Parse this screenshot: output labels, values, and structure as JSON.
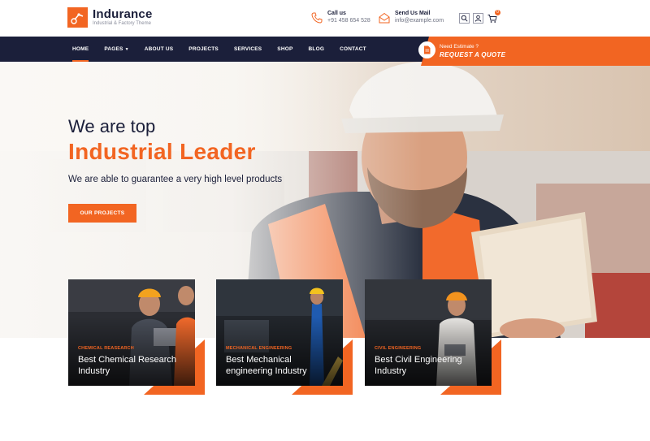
{
  "header": {
    "brand": "Indurance",
    "tagline": "Industrial & Factory Theme",
    "call_label": "Call us",
    "call_value": "+91 458 654 528",
    "mail_label": "Send Us Mail",
    "mail_value": "info@example.com",
    "cart_count": "0"
  },
  "nav": {
    "items": [
      "HOME",
      "PAGES",
      "ABOUT US",
      "PROJECTS",
      "SERVICES",
      "SHOP",
      "BLOG",
      "CONTACT"
    ],
    "quote_small": "Need Estimate ?",
    "quote_big": "REQUEST A QUOTE"
  },
  "hero": {
    "line1": "We are top",
    "title": "Industrial Leader",
    "desc": "We are able to guarantee a very high level products",
    "button": "OUR PROJECTS"
  },
  "cards": [
    {
      "category": "CHEMICAL REASEARCH",
      "title": "Best Chemical Research Industry"
    },
    {
      "category": "MECHANICAL ENGINEERING",
      "title": "Best Mechanical engineering Industry"
    },
    {
      "category": "CIVIL ENGINEERING",
      "title": "Best Civil Engineering Industry"
    }
  ],
  "colors": {
    "accent": "#f26522",
    "navy": "#1b1f3a"
  }
}
